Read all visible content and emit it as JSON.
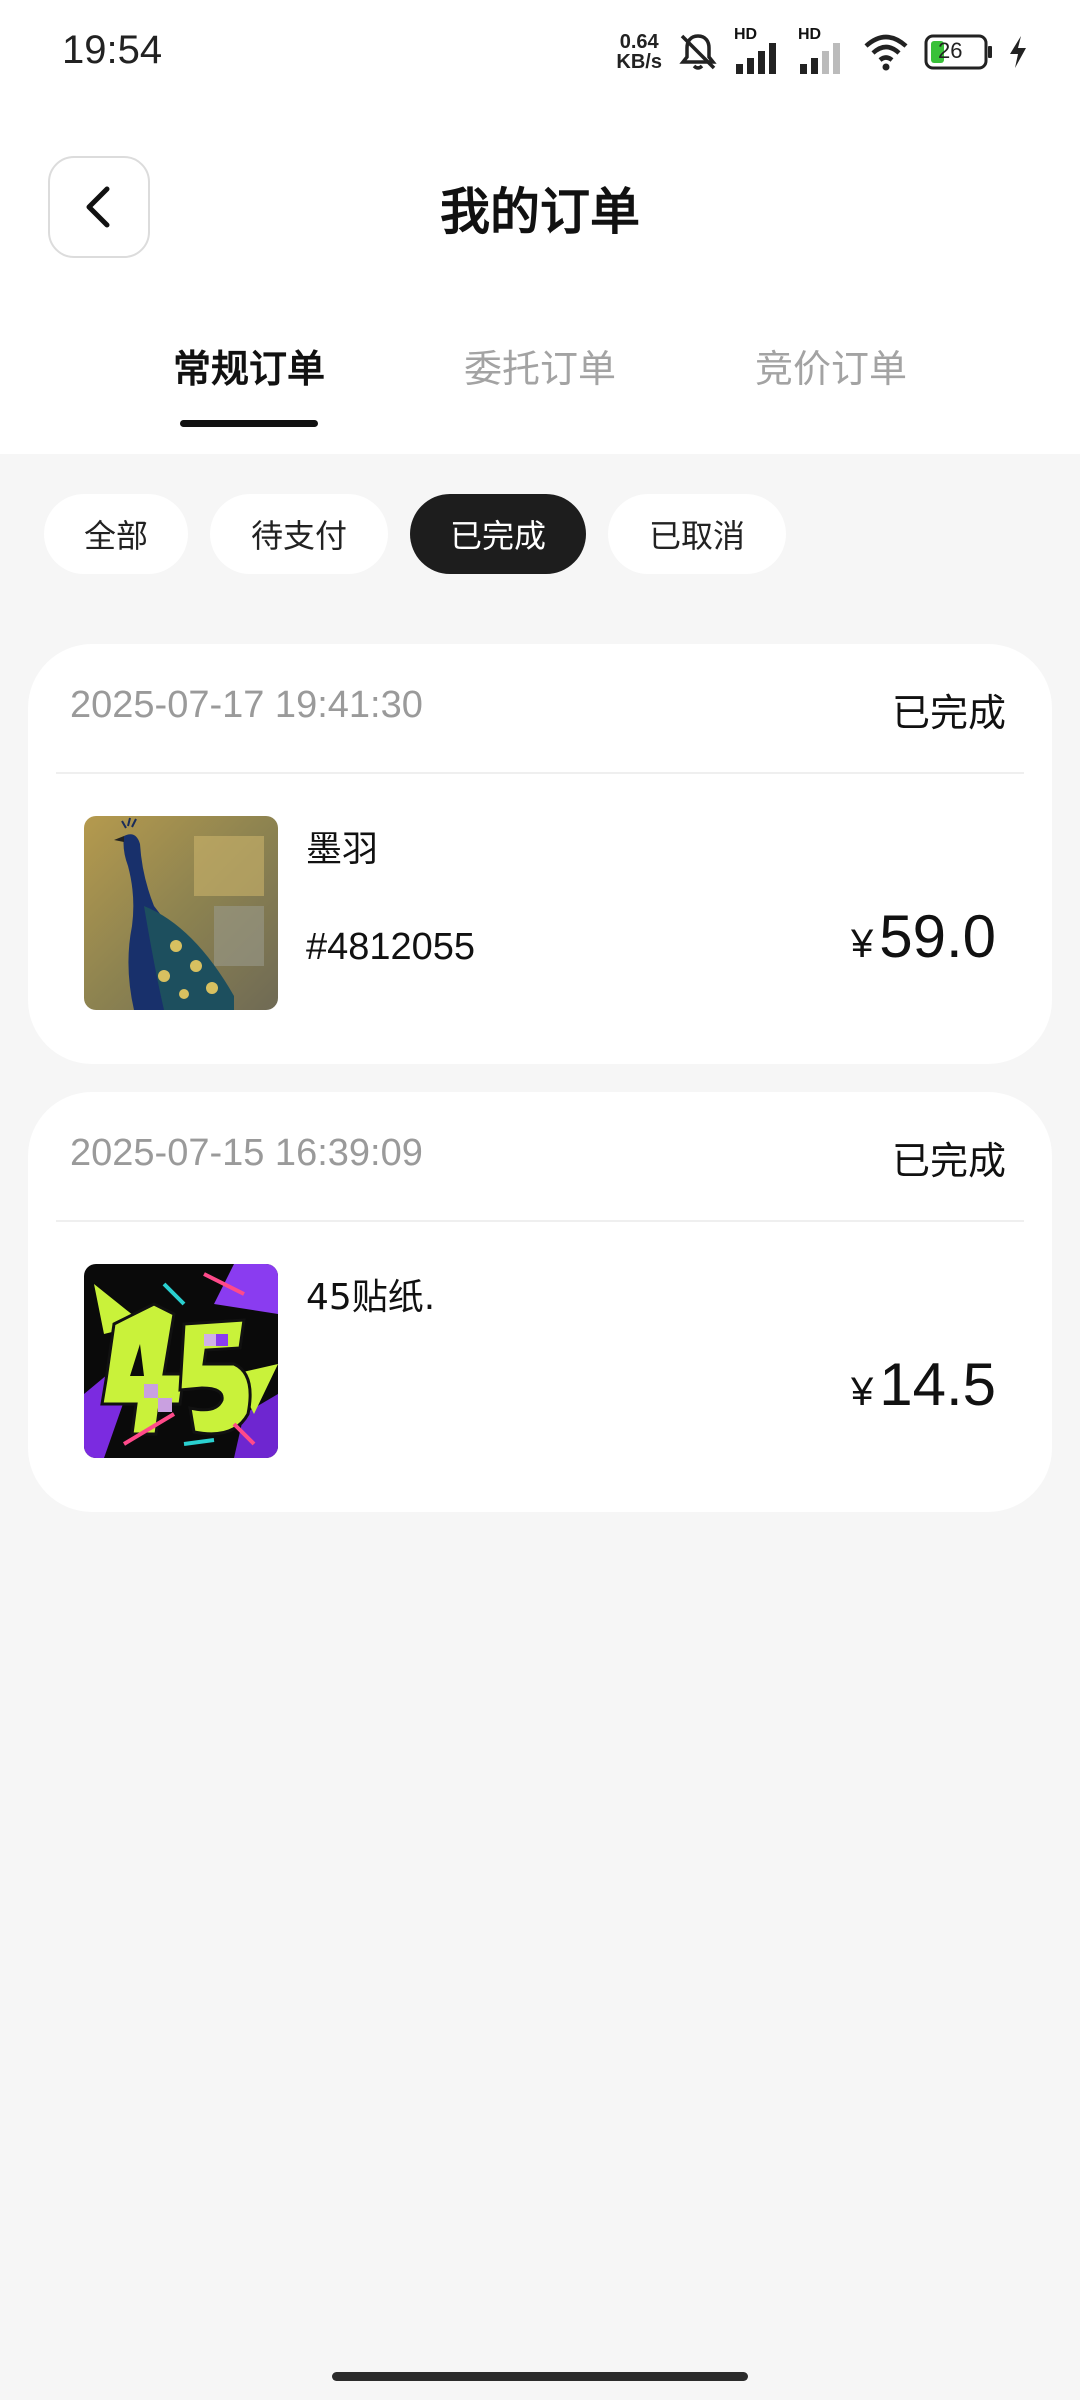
{
  "status_bar": {
    "time": "19:54",
    "net_speed_value": "0.64",
    "net_speed_unit": "KB/s",
    "signal1_label": "HD",
    "signal2_label": "HD",
    "battery": "26",
    "icons": [
      "mute-icon",
      "signal-icon",
      "signal-icon",
      "wifi-icon",
      "battery-icon",
      "charging-icon"
    ]
  },
  "header": {
    "title": "我的订单"
  },
  "tabs": [
    {
      "label": "常规订单",
      "active": true
    },
    {
      "label": "委托订单",
      "active": false
    },
    {
      "label": "竞价订单",
      "active": false
    }
  ],
  "filters": [
    {
      "label": "全部",
      "active": false
    },
    {
      "label": "待支付",
      "active": false
    },
    {
      "label": "已完成",
      "active": true
    },
    {
      "label": "已取消",
      "active": false
    }
  ],
  "orders": [
    {
      "datetime": "2025-07-17 19:41:30",
      "status": "已完成",
      "name": "墨羽",
      "code": "#4812055",
      "currency": "¥",
      "price": "59.0",
      "image": "peacock-artwork"
    },
    {
      "datetime": "2025-07-15 16:39:09",
      "status": "已完成",
      "name": "45贴纸.",
      "code": "",
      "currency": "¥",
      "price": "14.5",
      "image": "45-sticker-artwork"
    }
  ],
  "colors": {
    "background": "#f6f6f6",
    "card": "#ffffff",
    "active_chip": "#1d1d1d",
    "muted_text": "#9a9a9a"
  }
}
